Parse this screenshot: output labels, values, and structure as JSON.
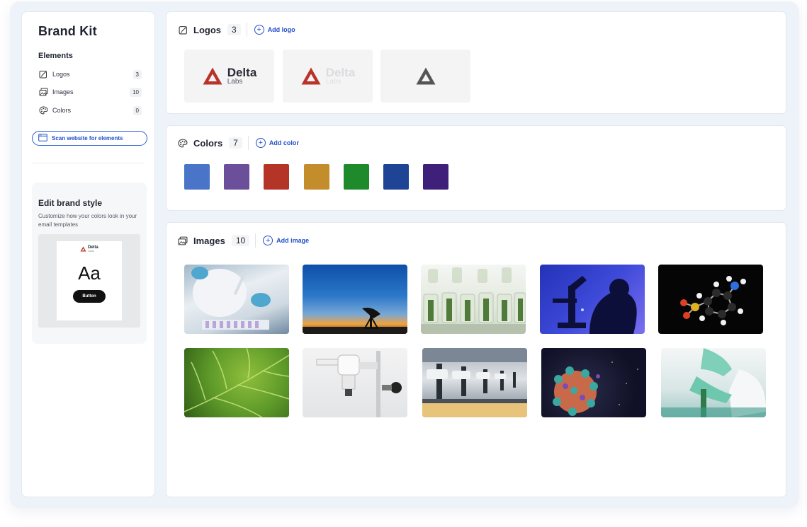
{
  "sidebar": {
    "title": "Brand Kit",
    "elements_heading": "Elements",
    "items": [
      {
        "label": "Logos",
        "count": "3",
        "icon": "edit-square-icon"
      },
      {
        "label": "Images",
        "count": "10",
        "icon": "images-icon"
      },
      {
        "label": "Colors",
        "count": "0",
        "icon": "palette-icon"
      }
    ],
    "scan_button": "Scan website for elements",
    "brand_style": {
      "title": "Edit brand style",
      "description": "Customize how your colors look in your email templates",
      "preview": {
        "logo_word": "Delta",
        "logo_sub": "Labs",
        "sample_text": "Aa",
        "button_label": "Button"
      }
    }
  },
  "logos": {
    "title": "Logos",
    "count": "3",
    "add_label": "Add logo",
    "items": [
      {
        "word": "Delta",
        "sub": "Labs",
        "variant": "color"
      },
      {
        "word": "Delta",
        "sub": "Labs",
        "variant": "light"
      },
      {
        "word": "",
        "sub": "",
        "variant": "mark-gray"
      }
    ]
  },
  "colors": {
    "title": "Colors",
    "count": "7",
    "add_label": "Add color",
    "swatches": [
      "#4a74c8",
      "#6b4f9b",
      "#b43428",
      "#c48d2c",
      "#1f8a2b",
      "#1f4395",
      "#3e1f7a"
    ]
  },
  "images": {
    "title": "Images",
    "count": "10",
    "add_label": "Add image",
    "items": [
      "lab-pipette-image",
      "radio-telescope-sunset-image",
      "plant-test-tubes-image",
      "microscope-silhouette-image",
      "molecule-model-image",
      "green-leaf-image",
      "microscope-white-image",
      "microscope-row-image",
      "virus-particle-image",
      "lab-gloves-image"
    ]
  },
  "brand_color": "#b8342a",
  "accent_color": "#2450c9"
}
